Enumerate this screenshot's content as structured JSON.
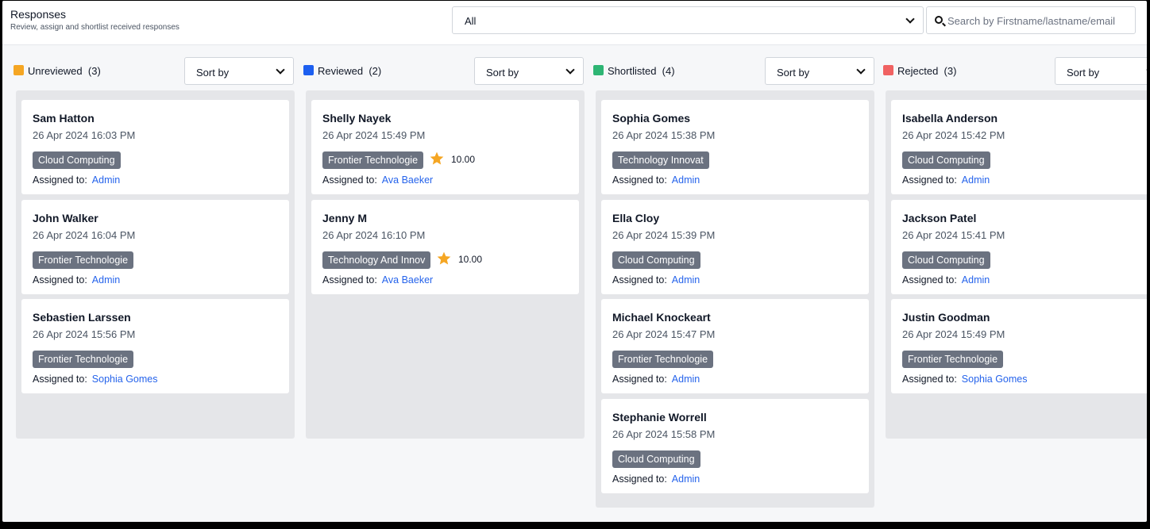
{
  "header": {
    "title": "Responses",
    "subtitle": "Review, assign and shortlist received responses",
    "filter_value": "All",
    "search_placeholder": "Search by Firstname/lastname/email"
  },
  "sort_label": "Sort by",
  "assigned_label": "Assigned to:",
  "colors": {
    "unreviewed": "#f5a623",
    "reviewed": "#1d5ff0",
    "shortlisted": "#2eb574",
    "rejected": "#f06262",
    "star": "#f5a623"
  },
  "columns": [
    {
      "id": "unreviewed",
      "label": "Unreviewed",
      "count": "(3)",
      "cards": [
        {
          "name": "Sam Hatton",
          "date": "26 Apr 2024 16:03 PM",
          "tag": "Cloud Computing",
          "assignee": "Admin"
        },
        {
          "name": "John Walker",
          "date": "26 Apr 2024 16:04 PM",
          "tag": "Frontier Technologie",
          "assignee": "Admin"
        },
        {
          "name": "Sebastien Larssen",
          "date": "26 Apr 2024 15:56 PM",
          "tag": "Frontier Technologie",
          "assignee": "Sophia Gomes"
        }
      ]
    },
    {
      "id": "reviewed",
      "label": "Reviewed",
      "count": "(2)",
      "cards": [
        {
          "name": "Shelly Nayek",
          "date": "26 Apr 2024 15:49 PM",
          "tag": "Frontier Technologie",
          "score": "10.00",
          "assignee": "Ava Baeker"
        },
        {
          "name": "Jenny M",
          "date": "26 Apr 2024 16:10 PM",
          "tag": "Technology And Innov",
          "score": "10.00",
          "assignee": "Ava Baeker"
        }
      ]
    },
    {
      "id": "shortlisted",
      "label": "Shortlisted",
      "count": "(4)",
      "cards": [
        {
          "name": "Sophia Gomes",
          "date": "26 Apr 2024 15:38 PM",
          "tag": "Technology Innovat",
          "assignee": "Admin"
        },
        {
          "name": "Ella Cloy",
          "date": "26 Apr 2024 15:39 PM",
          "tag": "Cloud Computing",
          "assignee": "Admin"
        },
        {
          "name": "Michael Knockeart",
          "date": "26 Apr 2024 15:47 PM",
          "tag": "Frontier Technologie",
          "assignee": "Admin"
        },
        {
          "name": "Stephanie Worrell",
          "date": "26 Apr 2024 15:58 PM",
          "tag": "Cloud Computing",
          "assignee": "Admin"
        }
      ]
    },
    {
      "id": "rejected",
      "label": "Rejected",
      "count": "(3)",
      "cards": [
        {
          "name": "Isabella Anderson",
          "date": "26 Apr 2024 15:42 PM",
          "tag": "Cloud Computing",
          "assignee": "Admin"
        },
        {
          "name": "Jackson Patel",
          "date": "26 Apr 2024 15:41 PM",
          "tag": "Cloud Computing",
          "assignee": "Admin"
        },
        {
          "name": "Justin Goodman",
          "date": "26 Apr 2024 15:49 PM",
          "tag": "Frontier Technologie",
          "assignee": "Sophia Gomes"
        }
      ]
    }
  ]
}
